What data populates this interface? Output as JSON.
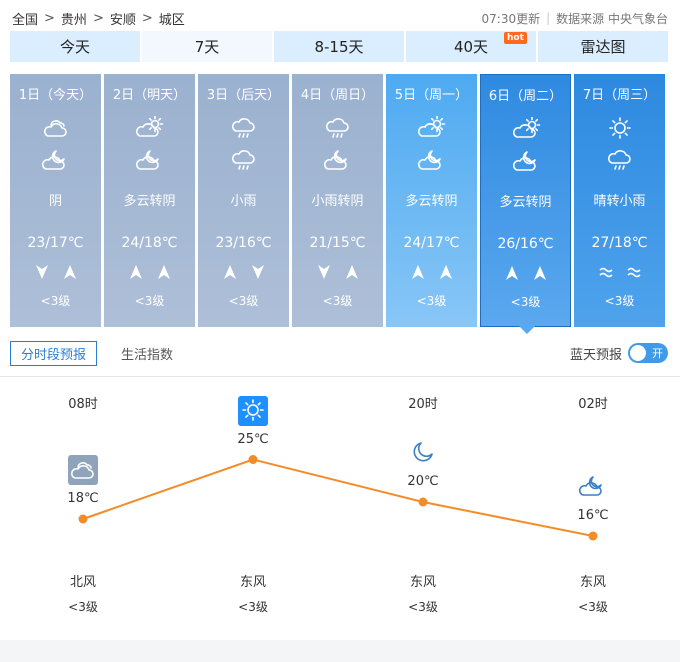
{
  "breadcrumb": [
    "全国",
    "贵州",
    "安顺",
    "城区"
  ],
  "source": {
    "updated": "07:30更新",
    "label": "数据来源 中央气象台"
  },
  "tabs": [
    {
      "label": "今天"
    },
    {
      "label": "7天"
    },
    {
      "label": "8-15天"
    },
    {
      "label": "40天",
      "badge": "hot"
    },
    {
      "label": "雷达图"
    }
  ],
  "days": [
    {
      "label": "1日（今天）",
      "icon1": "cloudy-icon",
      "icon2": "partly-cloudy-night-icon",
      "desc": "阴",
      "temp": "23/17℃",
      "wind1": "down",
      "wind2": "up",
      "level": "<3级"
    },
    {
      "label": "2日（明天）",
      "icon1": "partly-cloudy-icon",
      "icon2": "partly-cloudy-night-icon",
      "desc": "多云转阴",
      "temp": "24/18℃",
      "wind1": "up",
      "wind2": "up",
      "level": "<3级"
    },
    {
      "label": "3日（后天）",
      "icon1": "rain-icon",
      "icon2": "rain-icon",
      "desc": "小雨",
      "temp": "23/16℃",
      "wind1": "up",
      "wind2": "down",
      "level": "<3级"
    },
    {
      "label": "4日（周日）",
      "icon1": "rain-icon",
      "icon2": "partly-cloudy-night-icon",
      "desc": "小雨转阴",
      "temp": "21/15℃",
      "wind1": "down",
      "wind2": "up",
      "level": "<3级"
    },
    {
      "label": "5日（周一）",
      "icon1": "partly-cloudy-icon",
      "icon2": "partly-cloudy-night-icon",
      "desc": "多云转阴",
      "temp": "24/17℃",
      "wind1": "up",
      "wind2": "up",
      "level": "<3级"
    },
    {
      "label": "6日（周二）",
      "icon1": "partly-cloudy-icon",
      "icon2": "partly-cloudy-night-icon",
      "desc": "多云转阴",
      "temp": "26/16℃",
      "wind1": "up",
      "wind2": "up",
      "level": "<3级"
    },
    {
      "label": "7日（周三）",
      "icon1": "sun-icon",
      "icon2": "rain-icon",
      "desc": "晴转小雨",
      "temp": "27/18℃",
      "wind1": "wave",
      "wind2": "wave",
      "level": "<3级"
    }
  ],
  "subtabs": {
    "hourly": "分时段预报",
    "life": "生活指数"
  },
  "blue_sky": {
    "label": "蓝天预报",
    "toggle": "开"
  },
  "hourly": [
    {
      "time": "08时",
      "icon": "cloudy-icon",
      "temp": 18,
      "temp_label": "18℃",
      "wind": "北风",
      "level": "<3级"
    },
    {
      "time": "14时",
      "icon": "sun-icon",
      "temp": 25,
      "temp_label": "25℃",
      "wind": "东风",
      "level": "<3级"
    },
    {
      "time": "20时",
      "icon": "moon-icon",
      "temp": 20,
      "temp_label": "20℃",
      "wind": "东风",
      "level": "<3级"
    },
    {
      "time": "02时",
      "icon": "partly-cloudy-night-icon",
      "temp": 16,
      "temp_label": "16℃",
      "wind": "东风",
      "level": "<3级"
    }
  ],
  "colors": {
    "line": "#f28c28",
    "accent": "#2b7ed8",
    "sun": "#1e90ff"
  }
}
